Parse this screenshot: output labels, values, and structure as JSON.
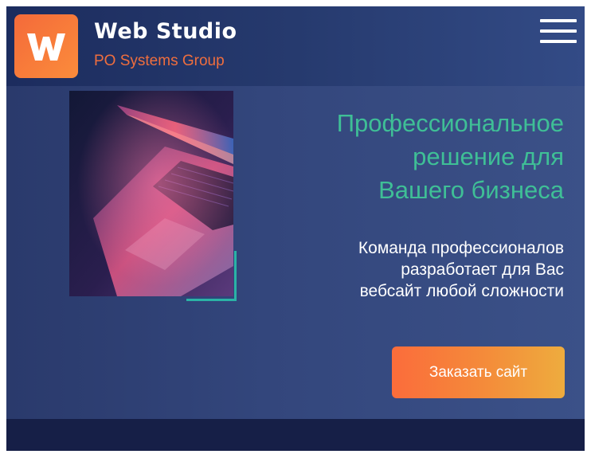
{
  "header": {
    "logo_letter": "W",
    "brand_title": "Web Studio",
    "brand_subtitle": "PO Systems Group",
    "menu_icon": "hamburger-menu-icon"
  },
  "hero": {
    "image_alt": "laptop-photo",
    "headline_lines": [
      "Профессиональное",
      "решение для",
      "Вашего бизнеса"
    ],
    "subtext_lines": [
      "Команда профессионалов",
      "разработает для Вас",
      "вебсайт любой сложности"
    ],
    "cta_label": "Заказать сайт"
  },
  "colors": {
    "accent_orange": "#fb6c3b",
    "headline_teal": "#3fbf96",
    "background_navy": "#2a3a6c"
  }
}
